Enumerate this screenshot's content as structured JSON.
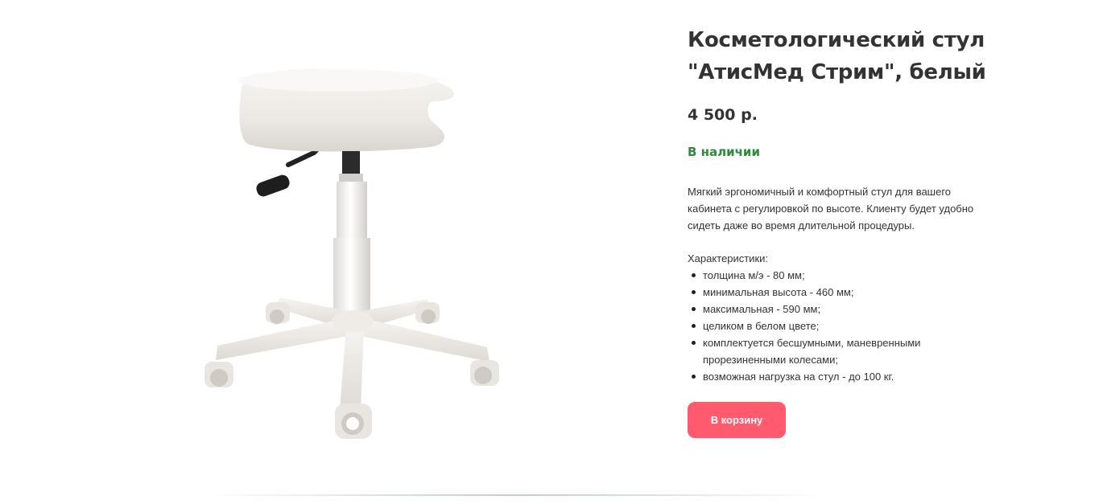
{
  "product": {
    "title_line1": "Косметологический стул",
    "title_line2": "\"АтисМед Стрим\", белый",
    "price": "4 500 р.",
    "availability": "В наличии",
    "description": "Мягкий эргономичный и комфортный стул для вашего кабинета с регулировкой по высоте. Клиенту будет удобно сидеть даже во время длительной процедуры.",
    "specs_heading": "Характеристики:",
    "specs": [
      "толщина м/э - 80 мм;",
      "минимальная высота - 460 мм;",
      "максимальная - 590 мм;",
      "целиком в белом цвете;",
      "комплектуется бесшумными, маневренными прорезиненными колесами;",
      "возможная нагрузка на стул - до 100 кг."
    ],
    "cart_button_label": "В корзину"
  },
  "colors": {
    "accent": "#ff5a6e",
    "availability": "#2e8b3e",
    "text": "#333333"
  }
}
